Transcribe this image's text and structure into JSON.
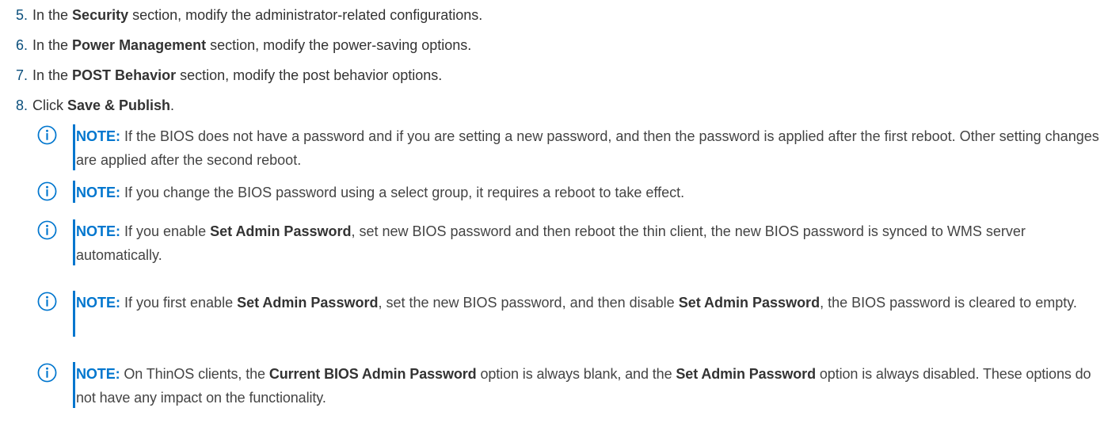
{
  "steps": [
    {
      "num": "5.",
      "pre": "In the ",
      "bold": "Security",
      "post": " section, modify the administrator-related configurations."
    },
    {
      "num": "6.",
      "pre": "In the ",
      "bold": "Power Management",
      "post": " section, modify the power-saving options."
    },
    {
      "num": "7.",
      "pre": "In the ",
      "bold": "POST Behavior",
      "post": " section, modify the post behavior options."
    },
    {
      "num": "8.",
      "pre": "Click ",
      "bold": "Save & Publish",
      "post": "."
    }
  ],
  "notes": [
    {
      "label": "NOTE:",
      "icon": "info-icon",
      "p1": " If the BIOS does not have a password and if you are setting a new password, and then the password is applied after the first reboot. Other setting changes are applied after the second reboot."
    },
    {
      "label": "NOTE:",
      "icon": "info-icon",
      "p1": " If you change the BIOS password using a select group, it requires a reboot to take effect."
    },
    {
      "label": "NOTE:",
      "icon": "info-icon",
      "p1": " If you enable ",
      "b1": "Set Admin Password",
      "p2": ", set new BIOS password and then reboot the thin client, the new BIOS password is synced to WMS server automatically."
    },
    {
      "label": "NOTE:",
      "icon": "info-icon",
      "p1": " If you first enable ",
      "b1": "Set Admin Password",
      "p2": ", set the new BIOS password, and then disable ",
      "b2": "Set Admin Password",
      "p3": ", the BIOS password is cleared to empty."
    },
    {
      "label": "NOTE:",
      "icon": "info-icon",
      "p1": " On ThinOS clients, the ",
      "b1": "Current BIOS Admin Password",
      "p2": " option is always blank, and the ",
      "b2": "Set Admin Password",
      "p3": " option is always disabled. These options do not have any impact on the functionality."
    }
  ],
  "colors": {
    "accent": "#0076ce",
    "step_number": "#0b4f7c",
    "text": "#333333"
  }
}
